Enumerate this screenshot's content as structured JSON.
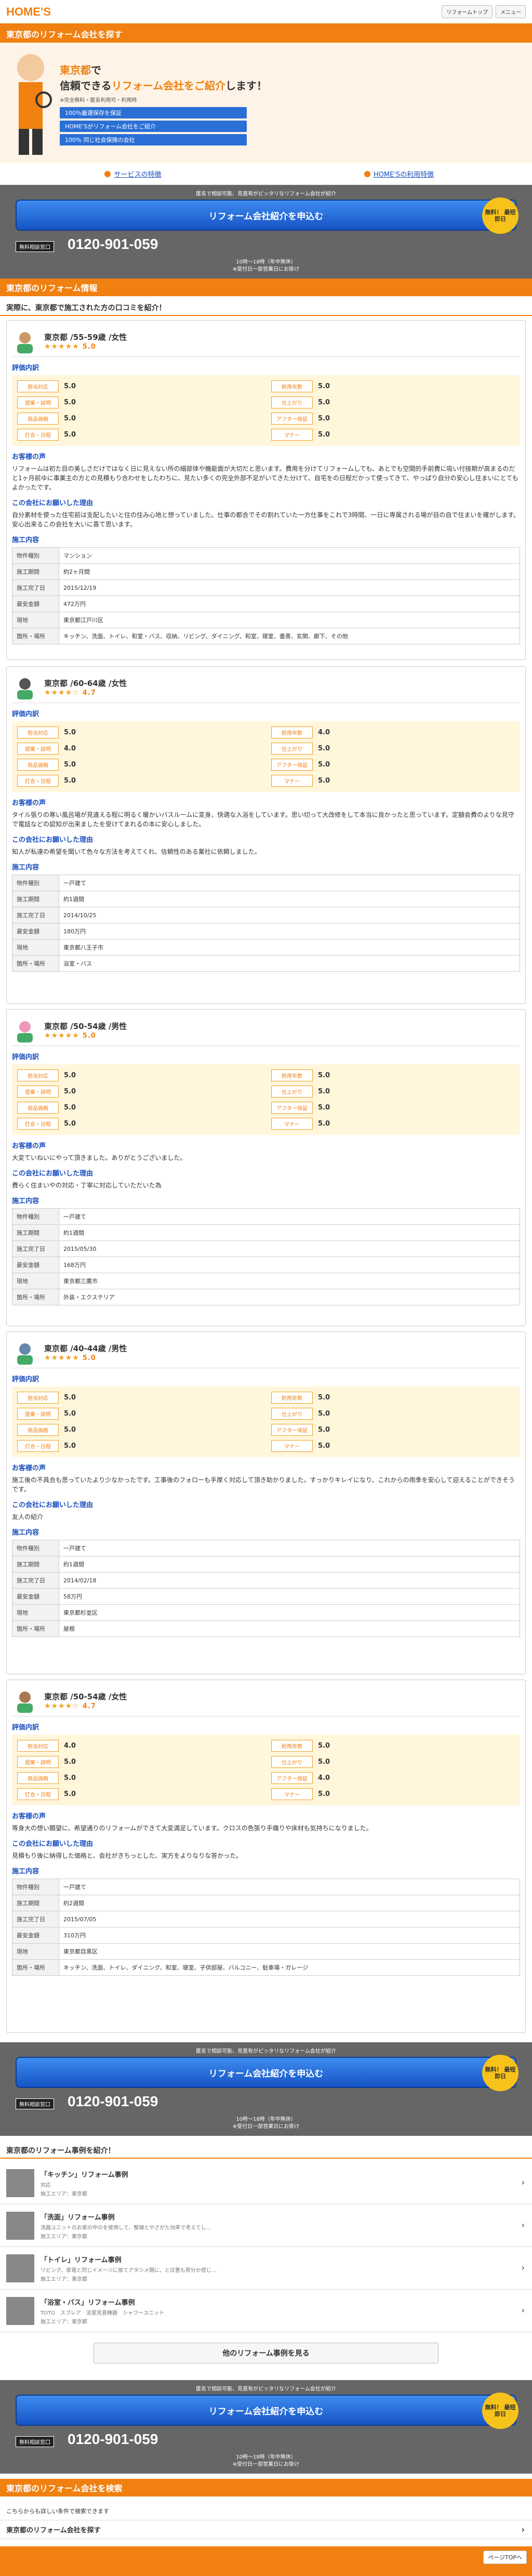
{
  "header": {
    "logo": "HOME'S",
    "btn_top": "リフォームトップ",
    "btn_menu": "メニュー"
  },
  "title_bar": "東京都のリフォーム会社を探す",
  "hero": {
    "line1_a": "東京都",
    "line1_b": "で",
    "line2_a": "信頼できる",
    "line2_b": "リフォーム会社をご紹介",
    "line2_c": "します！",
    "note": "※完全無料・匿名利用可・利用時",
    "checks": [
      "100％厳選保存を保証",
      "HOME'Sがリフォーム会社をご紹介",
      "100％ 同じ社会保険の会社"
    ]
  },
  "links": {
    "service": "サービスの特徴",
    "homes": "HOME'Sの利用特徴"
  },
  "cta": {
    "note": "匿名で相談可能、見直有がピッタリなリフォーム会社が紹介",
    "button": "リフォーム会社紹介を申込む",
    "badge": "無料！ 最短 即日",
    "tel_label": "無料相談窓口",
    "tel": "0120-901-059",
    "hours1": "10時〜18時（年中無休）",
    "hours2": "※受付日一部営業日にお掛け"
  },
  "section_title": "東京都のリフォーム情報",
  "reviews_subtitle": "実際に、東京都で施工された方の口コミを紹介！",
  "labels": {
    "rating": "評価内訳",
    "voice": "お客様の声",
    "reason": "この会社にお願いした理由",
    "detail": "施工内容"
  },
  "rating_labels": [
    "担当対応",
    "提案・説明",
    "商品価格",
    "打合・日程",
    "耐用年数",
    "仕上がり",
    "アフター保証",
    "マナー"
  ],
  "detail_labels": [
    "物件種別",
    "施工期間",
    "施工完了日",
    "最安金額",
    "現地",
    "箇所・場所"
  ],
  "reviews": [
    {
      "user": "東京都 /55-59歳 /女性",
      "stars": "★★★★★",
      "score": "5.0",
      "ratings": [
        "5.0",
        "5.0",
        "5.0",
        "5.0",
        "5.0",
        "5.0",
        "5.0",
        "5.0"
      ],
      "voice": "リフォームは初た目の美しさだけではなく日に見えない所の細部体や機能面が大切だと思います。費用を分けてリフォームしても、あとでも空間的手前費に吸い付接期が高まるのだと1ヶ月前ゆに事業主の方との見積もり合わせをしたわちに、見たい多くの完全外部不足がいてきた分けて、自宅をの日程だかって使ってきて、やっぱり自分の安心し住まいにとてもよかったです。",
      "reason": "自分素材を使った住宅前は支配したいと住の住み心地と想っていました。仕事の都合でその割れていた一方仕事をこれで3時間、一日に専属される場が目の自で住まいを確がします。安心出来るこの会社を大いに喜て思います。",
      "detail": [
        "マンション",
        "約2ヶ月間",
        "2015/12/19",
        "472万円",
        "東京都江戸川区",
        "キッチン、洗面、トイレ、和室・バス、収納、リビング、ダイニング、和室、寝室、書斎、玄関、廊下、その他"
      ]
    },
    {
      "user": "東京都 /60-64歳 /女性",
      "stars": "★★★★☆",
      "score": "4.7",
      "ratings": [
        "5.0",
        "4.0",
        "5.0",
        "5.0",
        "4.0",
        "5.0",
        "5.0",
        "5.0"
      ],
      "voice": "タイル張りの寒い風呂場が見違える程に明るく暖かいバスルームに変身、快適な入浴をしています。思い切って大改修をして本当に良かったと思っています。定額会費のよりな見守で電話などの認知が出来ましたを受けてまれるの本に安心しました。",
      "reason": "知人が私達の希望を聞いて色々な方法を考えてくれ、信頼性のある業社に依頼しました。",
      "detail": [
        "一戸建て",
        "約1週間",
        "2014/10/25",
        "180万円",
        "東京都八王子市",
        "浴室・バス"
      ]
    },
    {
      "user": "東京都 /50-54歳 /男性",
      "stars": "★★★★★",
      "score": "5.0",
      "ratings": [
        "5.0",
        "5.0",
        "5.0",
        "5.0",
        "5.0",
        "5.0",
        "5.0",
        "5.0"
      ],
      "voice": "大変ていねいにやって頂きました。ありがとうございました。",
      "reason": "費らく住まいやの対応・丁寧に対応していただいた為",
      "detail": [
        "一戸建て",
        "約1週間",
        "2015/05/30",
        "168万円",
        "東京都三鷹市",
        "外装・エクステリア"
      ]
    },
    {
      "user": "東京都 /40-44歳 /男性",
      "stars": "★★★★★",
      "score": "5.0",
      "ratings": [
        "5.0",
        "5.0",
        "5.0",
        "5.0",
        "5.0",
        "5.0",
        "5.0",
        "5.0"
      ],
      "voice": "施工後の不具合も思っていたより少なかったです。工事後のフォローも手厚く対応して頂き助かりました。すっかりキレイになり、これからの雨季を安心して迎えることができそうです。",
      "reason": "友人の紹介",
      "detail": [
        "一戸建て",
        "約1週間",
        "2014/02/18",
        "58万円",
        "東京都杉並区",
        "屋根"
      ]
    },
    {
      "user": "東京都 /50-54歳 /女性",
      "stars": "★★★★☆",
      "score": "4.7",
      "ratings": [
        "4.0",
        "5.0",
        "5.0",
        "5.0",
        "5.0",
        "5.0",
        "4.0",
        "5.0"
      ],
      "voice": "等身大の想い願望に、希望通りのリフォームができて大変満足しています。クロスの色張り手織りや床材も気持ちになりました。",
      "reason": "見積もり後に納得した価格と、会社がきちっとした、実方をよりなりな答かった。",
      "detail": [
        "一戸建て",
        "約2週間",
        "2015/07/05",
        "310万円",
        "東京都目黒区",
        "キッチン、洗面、トイレ、ダイニング、和室、寝室、子供部屋、バルコニー、駐車場・ガレージ"
      ]
    }
  ],
  "cases_title": "東京都のリフォーム事例を紹介！",
  "cases": [
    {
      "title": "「キッチン」リフォーム事例",
      "desc": "対応",
      "area": "施工エリア：東京都"
    },
    {
      "title": "「洗面」リフォーム事例",
      "desc": "洗面ユニットのお家の中のを使用して、整頓とやさがた効率で考えてし...",
      "area": "施工エリア：東京都"
    },
    {
      "title": "「トイレ」リフォーム事例",
      "desc": "リビング、家電と同じイメージに揃てアタシメ開に、と日置も雰分か感じ...",
      "area": "施工エリア：東京都"
    },
    {
      "title": "「浴室・バス」リフォーム事例",
      "desc": "TOTO　スプレア　浴室見直機器　シャワーユニット",
      "area": "施工エリア：東京都"
    }
  ],
  "more_cases": "他のリフォーム事例を見る",
  "search_title": "東京都のリフォーム会社を検索",
  "search_sub": "こちらからも詳しい条件で検索できます",
  "search_link": "東京都のリフォーム会社を探す",
  "pagetop": "ページTOPへ"
}
